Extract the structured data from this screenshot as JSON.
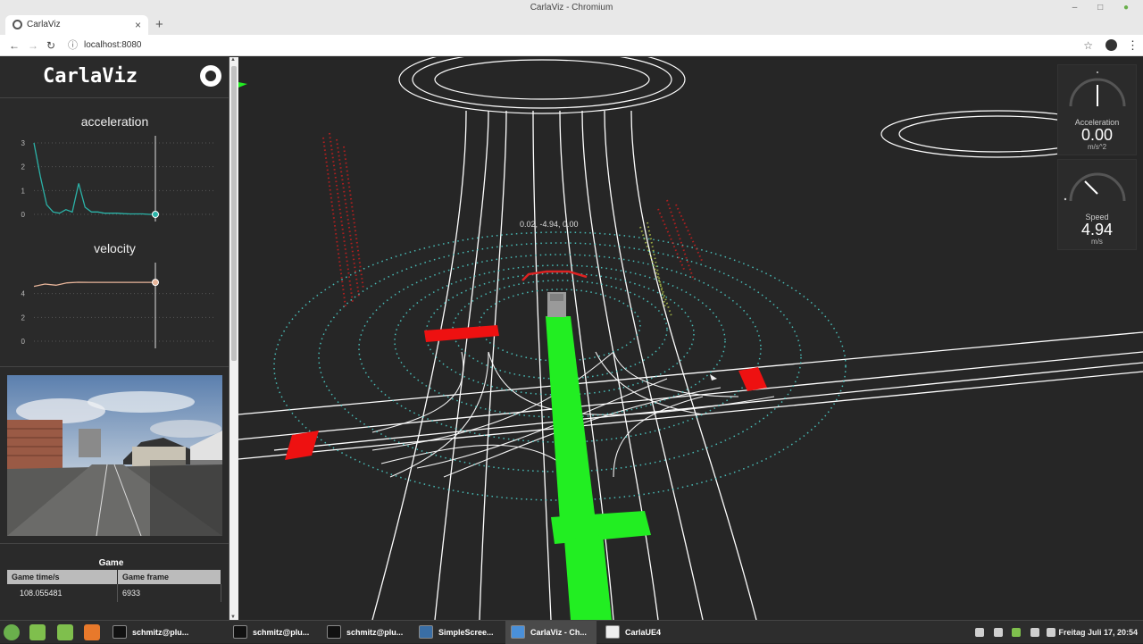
{
  "window": {
    "title": "CarlaViz - Chromium"
  },
  "browser": {
    "tab_title": "CarlaViz",
    "url": "localhost:8080"
  },
  "sidebar": {
    "app_title": "CarlaViz",
    "github_icon": "github-icon",
    "game": {
      "title": "Game",
      "headers": [
        "Game time/s",
        "Game frame"
      ],
      "values": [
        "108.055481",
        "6933"
      ]
    }
  },
  "chart_data": [
    {
      "type": "line",
      "title": "acceleration",
      "xlabel": "",
      "ylabel": "",
      "yticks": [
        0,
        1,
        2,
        3
      ],
      "ylim": [
        0,
        3
      ],
      "color": "#2bb3a8",
      "series": [
        {
          "values": [
            3.0,
            1.6,
            0.4,
            0.1,
            0.05,
            0.2,
            0.1,
            1.3,
            0.3,
            0.1,
            0.1,
            0.05,
            0.05,
            0.05,
            0.03,
            0.02,
            0.02,
            0.02,
            0.0,
            0.0
          ]
        }
      ]
    },
    {
      "type": "line",
      "title": "velocity",
      "xlabel": "",
      "ylabel": "",
      "yticks": [
        0,
        2,
        4
      ],
      "ylim": [
        0,
        6
      ],
      "color": "#e8b59a",
      "series": [
        {
          "values": [
            4.6,
            4.8,
            4.7,
            4.9,
            4.95,
            4.94,
            4.94,
            4.94,
            4.94,
            4.94,
            4.94,
            4.94
          ]
        }
      ]
    }
  ],
  "viewport": {
    "position_readout": "0.02, -4.94, 0.00"
  },
  "meters": {
    "acceleration": {
      "label": "Acceleration",
      "value": "0.00",
      "unit": "m/s^2",
      "fraction": 0.0
    },
    "speed": {
      "label": "Speed",
      "value": "4.94",
      "unit": "m/s",
      "fraction": 0.15
    }
  },
  "taskbar": {
    "tasks": [
      {
        "label": "schmitz@plu...",
        "icon": "terminal-icon"
      },
      {
        "label": "schmitz@plu...",
        "icon": "terminal-icon"
      },
      {
        "label": "schmitz@plu...",
        "icon": "terminal-icon"
      },
      {
        "label": "SimpleScree...",
        "icon": "camera-icon"
      },
      {
        "label": "CarlaViz - Ch...",
        "icon": "chromium-icon"
      },
      {
        "label": "CarlaUE4",
        "icon": "gear-icon"
      }
    ],
    "clock": "Freitag Juli 17, 20:54"
  },
  "colors": {
    "accent_green": "#22ee22",
    "obstacle_red": "#ee1111",
    "lane_white": "#ffffff",
    "lidar_cyan": "#4fd6d0"
  }
}
